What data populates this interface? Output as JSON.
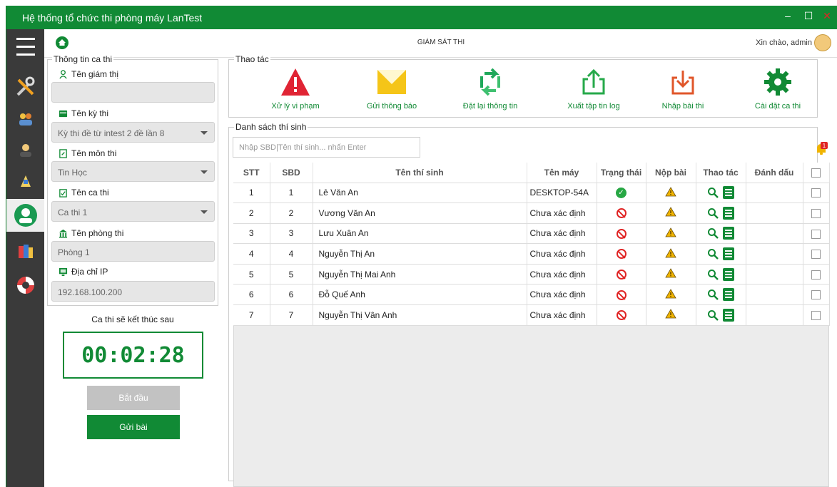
{
  "window": {
    "title": "Hệ thống tổ chức thi phòng máy LanTest",
    "controls": {
      "minimize": "‒",
      "maximize": "☐",
      "close": "✕"
    }
  },
  "topbar": {
    "title": "GIÁM SÁT THI",
    "greeting": "Xin chào, admin"
  },
  "sidebar": {
    "items": [
      "menu-icon",
      "tools-icon",
      "users-icon",
      "teacher-icon",
      "ticket-icon",
      "proctor-icon",
      "book-icon",
      "lifebuoy-icon"
    ],
    "active_item": "proctor-icon"
  },
  "session_info": {
    "section_title": "Thông tin ca thi",
    "proctor_label": "Tên giám thị",
    "proctor_value": "",
    "exam_label": "Tên kỳ thi",
    "exam_value": "Kỳ thi đề từ intest 2 đề lần 8",
    "subject_label": "Tên môn thi",
    "subject_value": "Tin Học",
    "shift_label": "Tên ca thi",
    "shift_value": "Ca thi 1",
    "room_label": "Tên phòng thi",
    "room_value": "Phòng 1",
    "ip_label": "Địa chỉ IP",
    "ip_value": "192.168.100.200"
  },
  "timer": {
    "title": "Ca thi sẽ kết thúc sau",
    "value": "00:02:28"
  },
  "buttons": {
    "start": "Bắt đầu",
    "submit": "Gửi bài"
  },
  "actions": {
    "section_title": "Thao tác",
    "items": [
      {
        "label": "Xử lý vi phạm",
        "icon": "warning-icon",
        "color": "#e02434"
      },
      {
        "label": "Gửi thông báo",
        "icon": "envelope-icon",
        "color": "#f5c518"
      },
      {
        "label": "Đặt lại thông tin",
        "icon": "reset-icon",
        "color": "#1fa85a"
      },
      {
        "label": "Xuất tập tin log",
        "icon": "export-icon",
        "color": "#26a94a"
      },
      {
        "label": "Nhập bài thi",
        "icon": "import-icon",
        "color": "#e0562a"
      },
      {
        "label": "Cài đặt ca thi",
        "icon": "gear-icon",
        "color": "#118a35"
      }
    ]
  },
  "candidates": {
    "section_title": "Danh sách thí sinh",
    "search_placeholder": "Nhập SBD|Tên thí sinh... nhấn Enter",
    "notification_count": "1",
    "columns": [
      "STT",
      "SBD",
      "Tên thí sinh",
      "Tên máy",
      "Trạng thái",
      "Nộp bài",
      "Thao tác",
      "Đánh dấu"
    ],
    "rows": [
      {
        "stt": "1",
        "sbd": "1",
        "name": "Lê Văn An",
        "machine": "DESKTOP-54A",
        "status": "online"
      },
      {
        "stt": "2",
        "sbd": "2",
        "name": "Vương Văn An",
        "machine": "Chưa xác định",
        "status": "offline"
      },
      {
        "stt": "3",
        "sbd": "3",
        "name": "Lưu Xuân An",
        "machine": "Chưa xác định",
        "status": "offline"
      },
      {
        "stt": "4",
        "sbd": "4",
        "name": "Nguyễn Thị An",
        "machine": "Chưa xác định",
        "status": "offline"
      },
      {
        "stt": "5",
        "sbd": "5",
        "name": "Nguyễn Thị Mai Anh",
        "machine": "Chưa xác định",
        "status": "offline"
      },
      {
        "stt": "6",
        "sbd": "6",
        "name": "Đỗ Quế Anh",
        "machine": "Chưa xác định",
        "status": "offline"
      },
      {
        "stt": "7",
        "sbd": "7",
        "name": "Nguyễn Thị Vân Anh",
        "machine": "Chưa xác định",
        "status": "offline"
      }
    ]
  },
  "colors": {
    "brand": "#118a35",
    "sidebar": "#3a3a3a",
    "danger": "#e02424",
    "warning": "#f0b400"
  }
}
